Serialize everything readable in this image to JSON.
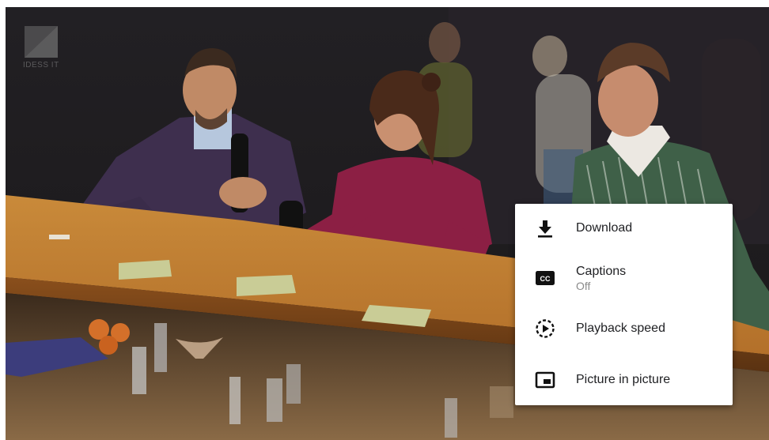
{
  "player": {
    "watermark": "IDESS IT"
  },
  "menu": {
    "items": [
      {
        "label": "Download",
        "icon": "download-icon"
      },
      {
        "label": "Captions",
        "sub": "Off",
        "icon": "closed-captions-icon"
      },
      {
        "label": "Playback speed",
        "icon": "playback-speed-icon"
      },
      {
        "label": "Picture in picture",
        "icon": "picture-in-picture-icon"
      }
    ]
  }
}
